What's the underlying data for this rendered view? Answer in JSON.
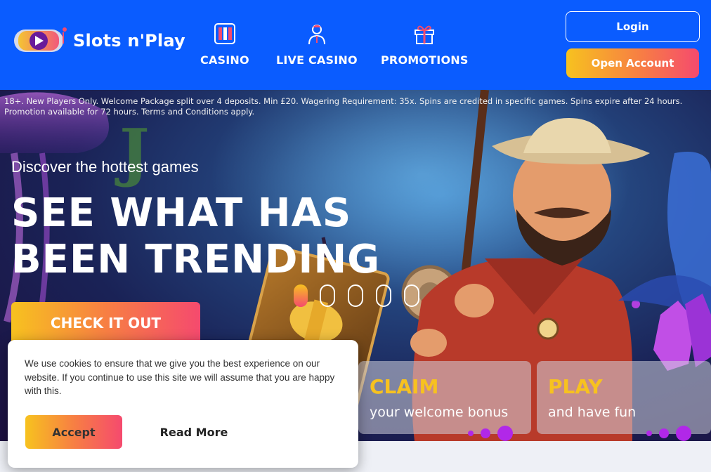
{
  "header": {
    "brand": "Slots n'Play",
    "nav": [
      {
        "label": "CASINO",
        "icon": "slot-machine-icon"
      },
      {
        "label": "LIVE CASINO",
        "icon": "live-dealer-icon"
      },
      {
        "label": "PROMOTIONS",
        "icon": "gift-icon"
      }
    ],
    "login_label": "Login",
    "open_account_label": "Open Account"
  },
  "hero": {
    "disclaimer": "18+. New Players Only. Welcome Package split over 4 deposits. Min £20. Wagering Requirement: 35x. Spins are credited in specific games. Spins expire after 24 hours. Promotion available for 72 hours. Terms and Conditions apply.",
    "kicker": "Discover the hottest games",
    "headline": "SEE WHAT HAS BEEN TRENDING",
    "cta_label": "CHECK IT OUT",
    "slides_total": 5,
    "slide_active": 1
  },
  "promos": [
    {
      "big": "CLAIM",
      "small": "your welcome bonus"
    },
    {
      "big": "PLAY",
      "small": "and have fun"
    }
  ],
  "cookie": {
    "message": "We use cookies to ensure that we give you the best experience on our website. If you continue to use this site we will assume that you are happy with this.",
    "accept_label": "Accept",
    "read_more_label": "Read More"
  },
  "colors": {
    "header_bg": "#0a5cff",
    "accent_yellow": "#f7c21f",
    "accent_pink": "#f54a6e",
    "pager_purple": "#b128e8"
  }
}
